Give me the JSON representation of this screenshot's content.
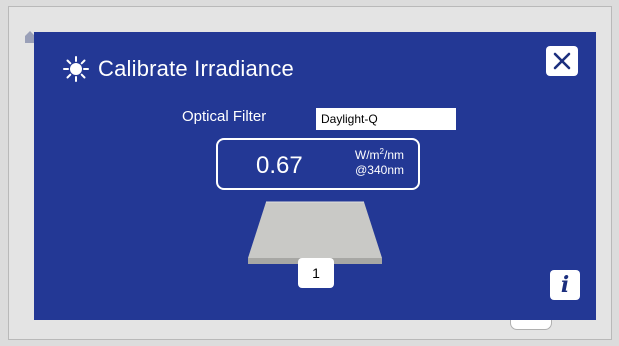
{
  "dialog": {
    "title": "Calibrate Irradiance",
    "title_icon": "sun-icon",
    "close_icon": "close-icon",
    "background": "#233895"
  },
  "filter": {
    "label": "Optical Filter",
    "value": "Daylight-Q"
  },
  "reading": {
    "value": "0.67",
    "unit_prefix": "W/m",
    "unit_exponent": "2",
    "unit_suffix": "/nm",
    "wavelength": "@340nm"
  },
  "sample": {
    "position": "1"
  },
  "info": {
    "glyph": "i",
    "icon": "info-icon"
  }
}
